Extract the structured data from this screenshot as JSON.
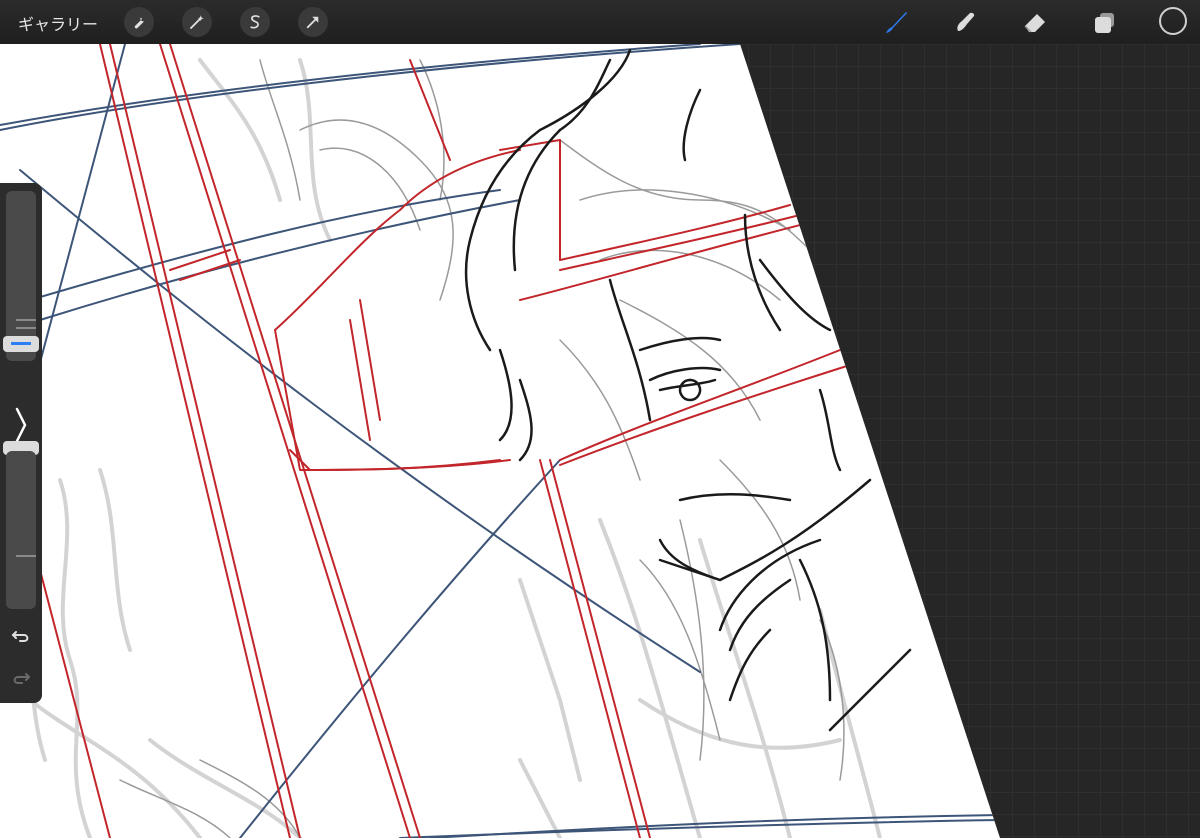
{
  "topbar": {
    "gallery_label": "ギャラリー",
    "left_tools": [
      {
        "icon": "wrench-icon",
        "name": "actions"
      },
      {
        "icon": "magic-wand-icon",
        "name": "adjustments"
      },
      {
        "icon": "selection-s-icon",
        "name": "selection"
      },
      {
        "icon": "arrow-cursor-icon",
        "name": "transform"
      }
    ],
    "right_tools": [
      {
        "icon": "brush-icon",
        "name": "paint",
        "active": true
      },
      {
        "icon": "smudge-icon",
        "name": "smudge",
        "active": false
      },
      {
        "icon": "eraser-icon",
        "name": "erase",
        "active": false
      },
      {
        "icon": "layers-icon",
        "name": "layers",
        "active": false
      }
    ],
    "color_swatch": "#1a1a1a"
  },
  "sidebar": {
    "brush_size_level": 0.15,
    "brush_opacity_level": 0.9,
    "modify_icon": "chevron-right-icon",
    "undo_icon": "undo-icon",
    "redo_icon": "redo-icon"
  },
  "colors": {
    "accent": "#2d7df6",
    "sketch_red": "#c2262b",
    "sketch_blue": "#3d5578",
    "sketch_gray": "#c8c8c8",
    "sketch_black": "#1a1a1a",
    "interface_bg": "#262626"
  }
}
